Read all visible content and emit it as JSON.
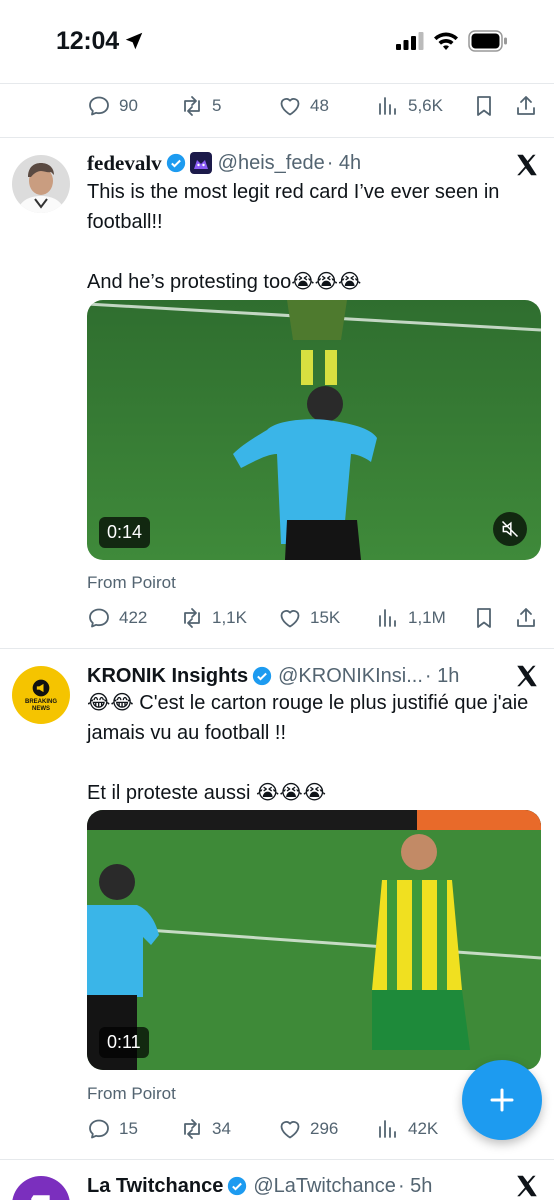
{
  "status_bar": {
    "time": "12:04"
  },
  "prev_tweet": {
    "stats": {
      "replies": "90",
      "reposts": "5",
      "likes": "48",
      "views": "5,6K"
    }
  },
  "tweets": [
    {
      "name": "fedevalv",
      "handle": "@heis_fede",
      "time": "· 4h",
      "text_line1": "This is the most legit red card I’ve ever seen in football!!",
      "text_line2": "And he’s protesting too😭😭😭",
      "video_duration": "0:14",
      "from": "From Poirot",
      "stats": {
        "replies": "422",
        "reposts": "1,1K",
        "likes": "15K",
        "views": "1,1M"
      }
    },
    {
      "name": "KRONIK Insights",
      "handle": "@KRONIKInsi...",
      "time": "· 1h",
      "avatar_text": "BREAKING NEWS",
      "text_line1": "😂😂 C'est le carton rouge le plus justifié que j'aie jamais vu au football !!",
      "text_line2": "Et il proteste aussi 😭😭😭",
      "video_duration": "0:11",
      "from": "From Poirot",
      "stats": {
        "replies": "15",
        "reposts": "34",
        "likes": "296",
        "views": "42K"
      }
    },
    {
      "name": "La Twitchance",
      "handle": "@LaTwitchance",
      "time": "· 5h"
    }
  ],
  "colors": {
    "accent": "#1d9bf0",
    "secondary_text": "#536471",
    "verified": "#1d9bf0"
  },
  "icons": [
    "location-arrow-icon",
    "signal-icon",
    "wifi-icon",
    "battery-icon",
    "reply-icon",
    "repost-icon",
    "like-icon",
    "views-icon",
    "bookmark-icon",
    "share-icon",
    "verified-icon",
    "x-logo-icon",
    "mute-icon",
    "compose-icon"
  ]
}
